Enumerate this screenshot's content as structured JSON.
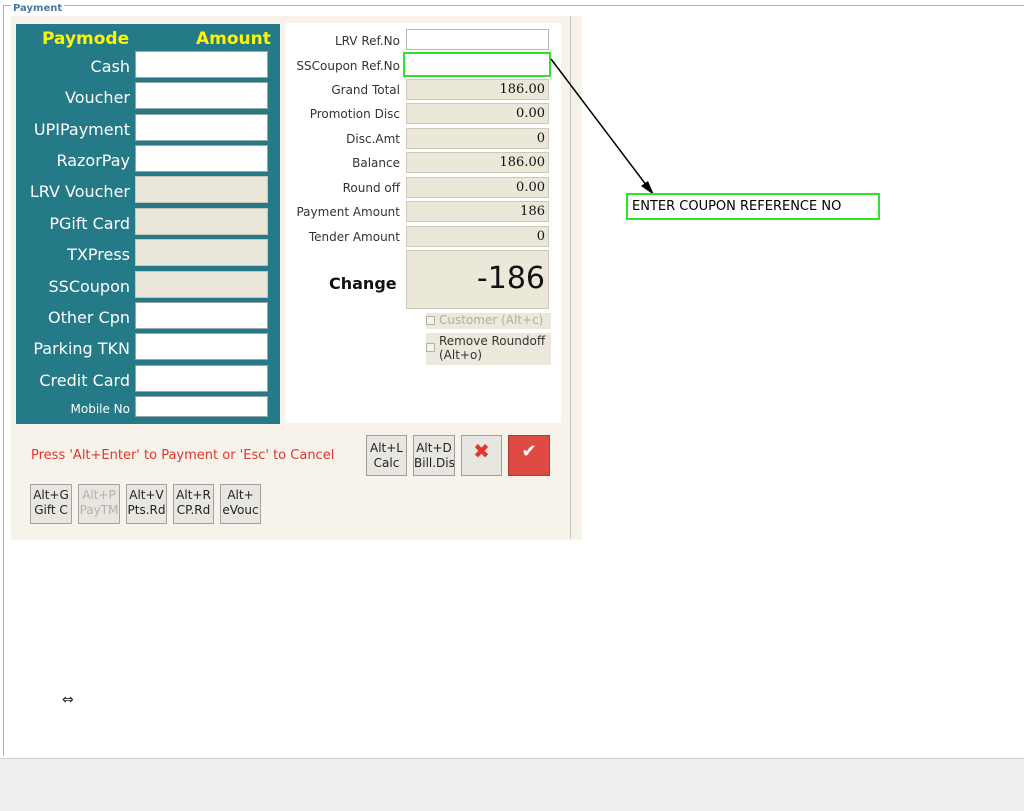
{
  "window": {
    "legend": "Payment"
  },
  "paymodes": {
    "header_left": "Paymode",
    "header_right": "Amount",
    "rows": [
      {
        "label": "Cash",
        "value": "",
        "enabled": true
      },
      {
        "label": "Voucher",
        "value": "",
        "enabled": true
      },
      {
        "label": "UPIPayment",
        "value": "",
        "enabled": true
      },
      {
        "label": "RazorPay",
        "value": "",
        "enabled": true
      },
      {
        "label": "LRV Voucher",
        "value": "",
        "enabled": false
      },
      {
        "label": "PGift Card",
        "value": "",
        "enabled": false
      },
      {
        "label": "TXPress",
        "value": "",
        "enabled": false
      },
      {
        "label": "SSCoupon",
        "value": "",
        "enabled": false
      },
      {
        "label": "Other Cpn",
        "value": "",
        "enabled": true
      },
      {
        "label": "Parking TKN",
        "value": "",
        "enabled": true
      },
      {
        "label": "Credit Card",
        "value": "",
        "enabled": true
      }
    ],
    "mobile_label": "Mobile No",
    "mobile_value": ""
  },
  "summary": {
    "lrv_ref_label": "LRV Ref.No",
    "lrv_ref_value": "",
    "sscoupon_ref_label": "SSCoupon Ref.No",
    "sscoupon_ref_value": "",
    "grand_total_label": "Grand Total",
    "grand_total": "186.00",
    "promotion_label": "Promotion Disc",
    "promotion": "0.00",
    "disc_amt_label": "Disc.Amt",
    "disc_amt": "0",
    "balance_label": "Balance",
    "balance": "186.00",
    "roundoff_label": "Round off",
    "roundoff": "0.00",
    "payment_amount_label": "Payment Amount",
    "payment_amount": "186",
    "tender_label": "Tender Amount",
    "tender": "0",
    "change_label": "Change",
    "change": "-186",
    "customer_checkbox": "Customer (Alt+c)",
    "remove_roundoff_checkbox": "Remove Roundoff (Alt+o)",
    "remove_roundoff_line1": "Remove Roundoff",
    "remove_roundoff_line2": "(Alt+o)"
  },
  "footer": {
    "message": "Press 'Alt+Enter' to Payment or 'Esc' to Cancel",
    "calc": {
      "line1": "Alt+L",
      "line2": "Calc"
    },
    "billdis": {
      "line1": "Alt+D",
      "line2": "Bill.Dis"
    },
    "cancel_icon": "close-icon",
    "ok_icon": "check-icon",
    "shortcuts": [
      {
        "line1": "Alt+G",
        "line2": "Gift C",
        "enabled": true
      },
      {
        "line1": "Alt+P",
        "line2": "PayTM",
        "enabled": false
      },
      {
        "line1": "Alt+V",
        "line2": "Pts.Rd",
        "enabled": true
      },
      {
        "line1": "Alt+R",
        "line2": "CP.Rd",
        "enabled": true
      },
      {
        "line1": "Alt+",
        "line2": "eVouc",
        "enabled": true
      }
    ]
  },
  "annotation": {
    "text": "ENTER COUPON REFERENCE NO",
    "color": "#31e22c"
  },
  "colors": {
    "teal": "#257a88",
    "header_yellow": "#fff700",
    "cancel_red": "#e0372d",
    "ok_red": "#de4b43"
  },
  "resize_icon": "horizontal-resize-icon"
}
